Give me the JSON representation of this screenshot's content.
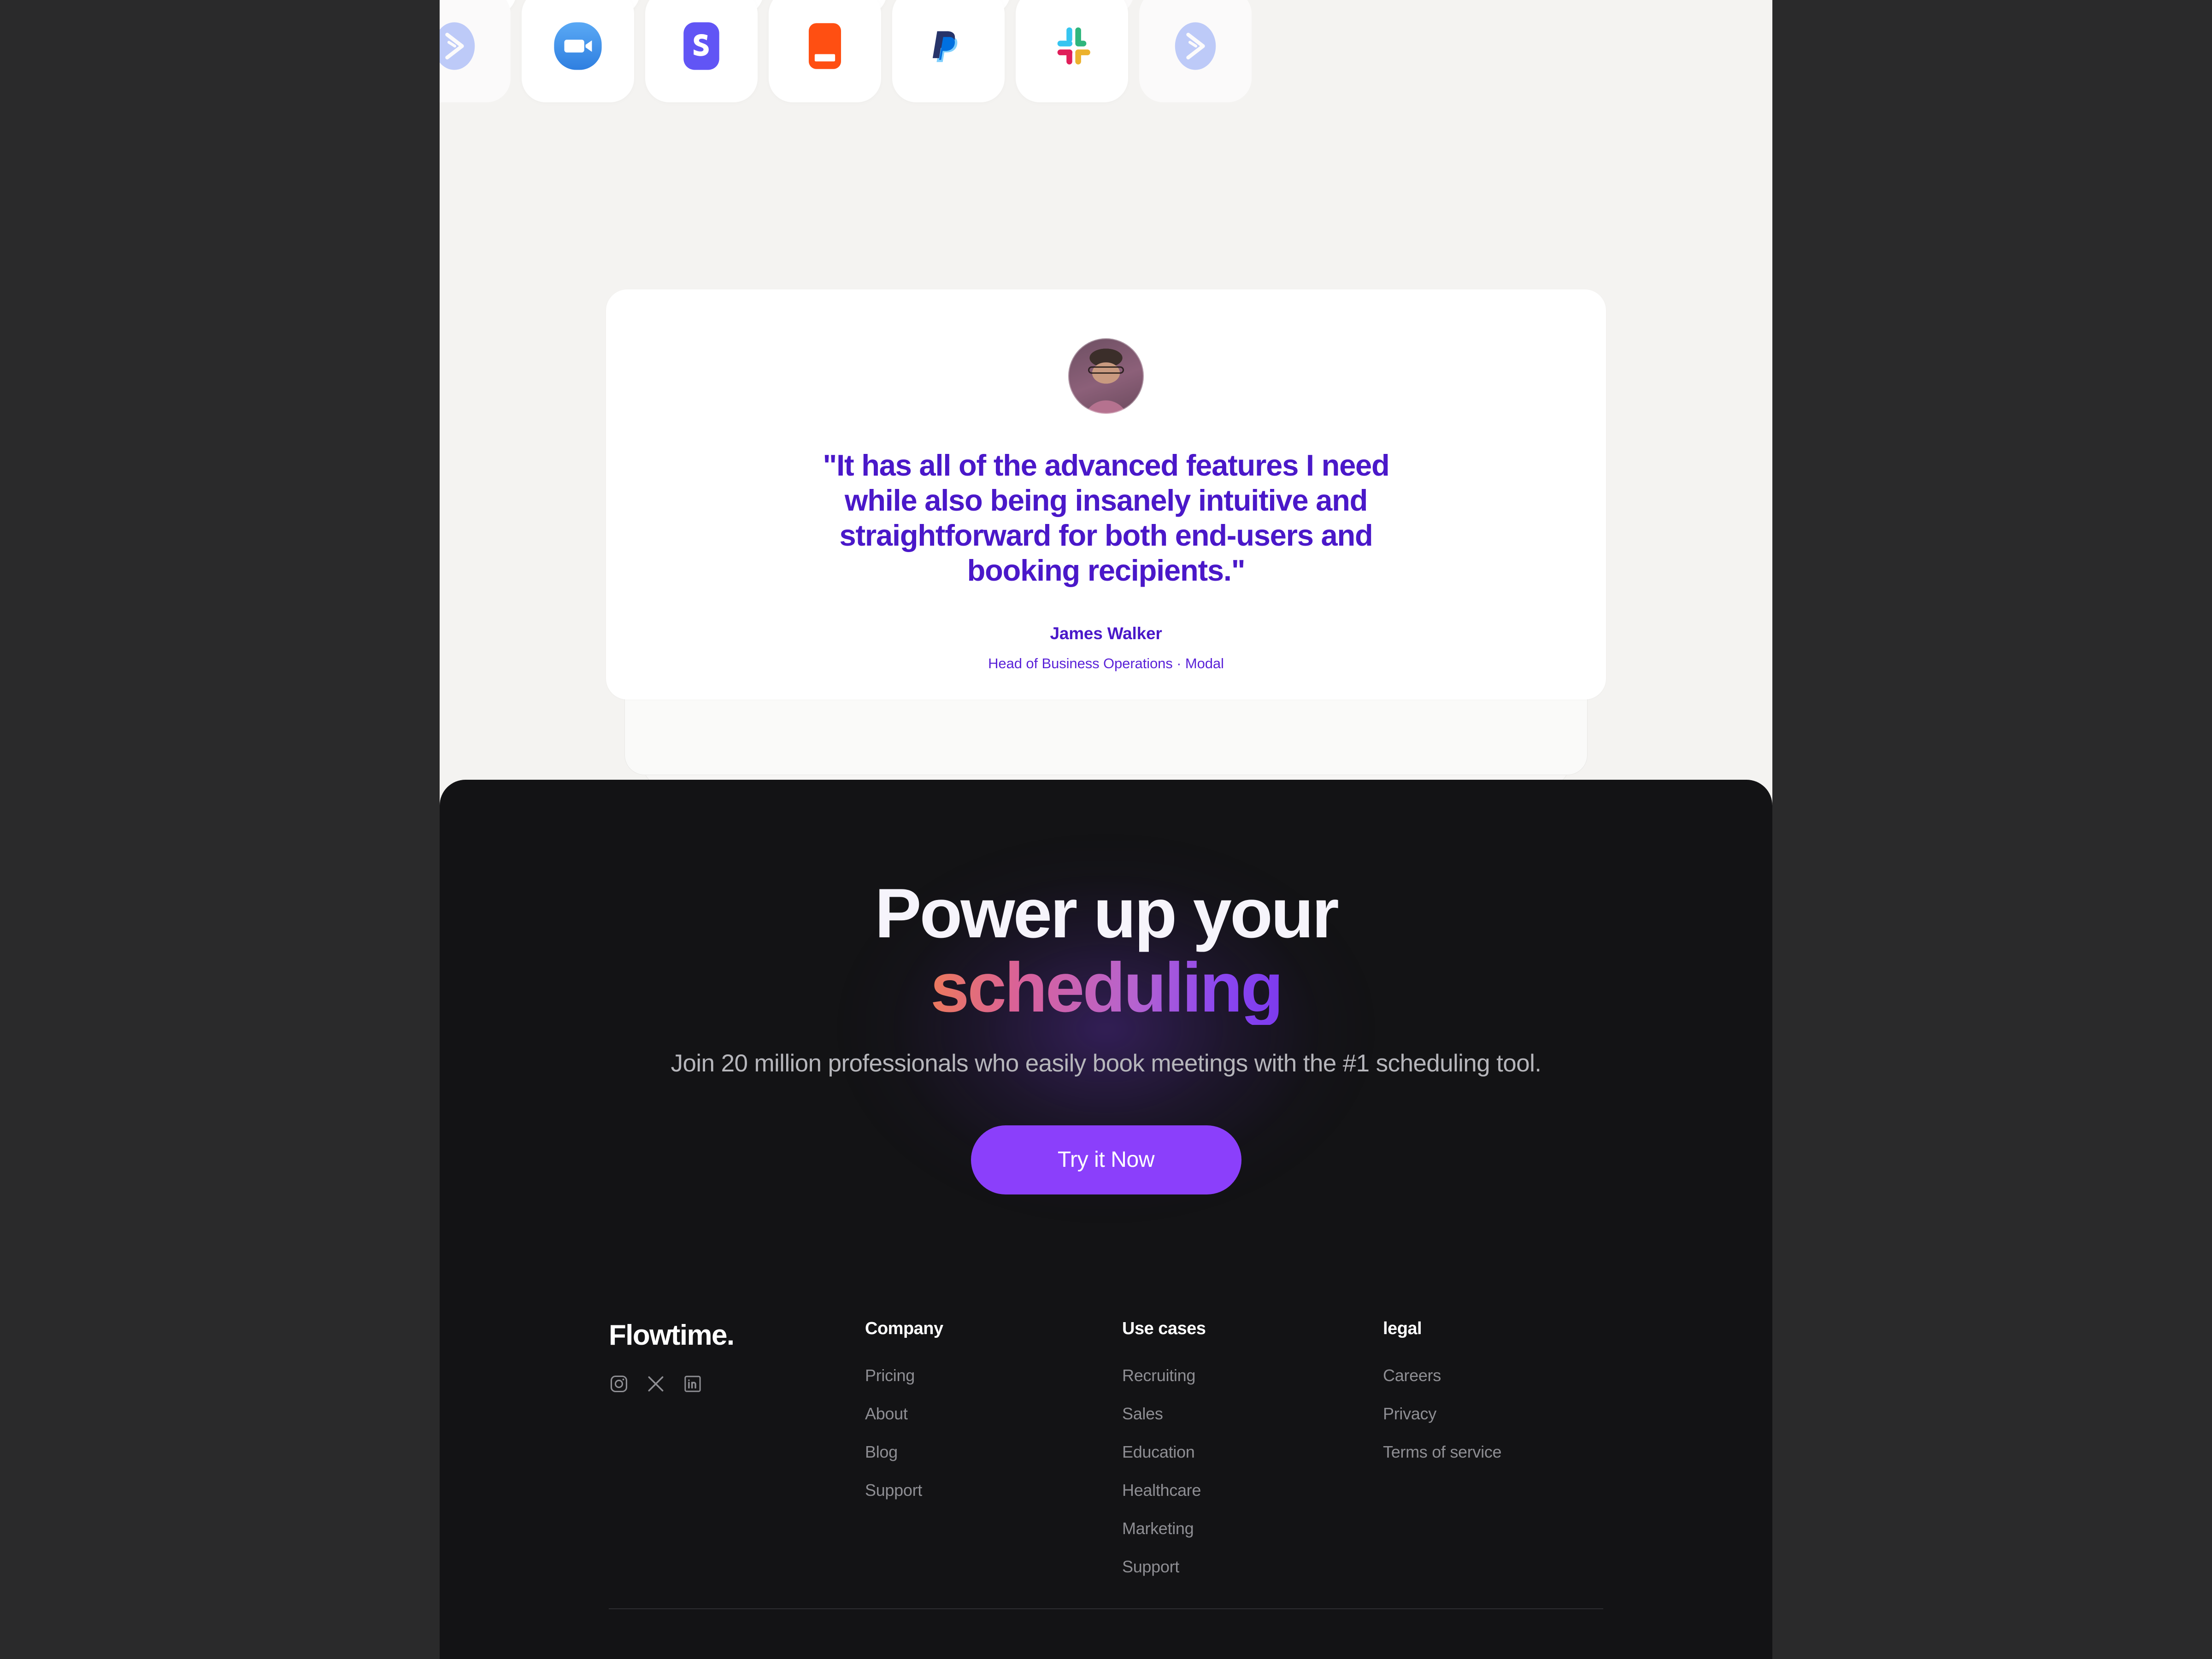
{
  "integrations": {
    "row1": [
      {
        "name": "zoom",
        "faded": true
      },
      {
        "name": "stripe",
        "faded": false
      },
      {
        "name": "hubspot",
        "faded": false
      },
      {
        "name": "paypal",
        "faded": false
      },
      {
        "name": "slack",
        "faded": false
      },
      {
        "name": "activecampaign",
        "faded": false
      },
      {
        "name": "zoom",
        "faded": true
      }
    ],
    "row2": [
      {
        "name": "activecampaign",
        "faded": true
      },
      {
        "name": "zoom",
        "faded": false
      },
      {
        "name": "stripe",
        "faded": false
      },
      {
        "name": "hubspot",
        "faded": false
      },
      {
        "name": "paypal",
        "faded": false
      },
      {
        "name": "slack",
        "faded": false
      },
      {
        "name": "activecampaign",
        "faded": true
      }
    ]
  },
  "testimonial": {
    "quote": "\"It has all of the advanced features I need while also being insanely intuitive and straightforward for both end-users and booking recipients.\"",
    "author": "James Walker",
    "role": "Head of Business Operations · Modal",
    "avatar_alt": "James Walker portrait"
  },
  "cta": {
    "heading_line1": "Power up your",
    "heading_line2": "scheduling",
    "subtext": "Join 20 million professionals who easily book meetings with the #1 scheduling tool.",
    "button_label": "Try it Now",
    "button_color": "#8b3ffb",
    "gradient_from": "#ec7a5a",
    "gradient_to": "#7c3aed"
  },
  "footer": {
    "brand": "Flowtime.",
    "socials": [
      {
        "name": "instagram"
      },
      {
        "name": "x-twitter"
      },
      {
        "name": "linkedin"
      }
    ],
    "columns": [
      {
        "heading": "Company",
        "links": [
          "Pricing",
          "About",
          "Blog",
          "Support"
        ]
      },
      {
        "heading": "Use cases",
        "links": [
          "Recruiting",
          "Sales",
          "Education",
          "Healthcare",
          "Marketing",
          "Support"
        ]
      },
      {
        "heading": "legal",
        "links": [
          "Careers",
          "Privacy",
          "Terms of service"
        ]
      }
    ]
  },
  "theme": {
    "page_bg": "#f4f3f1",
    "outside_bg": "#2a2a2b",
    "dark_bg": "#131315",
    "accent_purple": "#4a18c9",
    "cta_purple": "#8b3ffb"
  }
}
